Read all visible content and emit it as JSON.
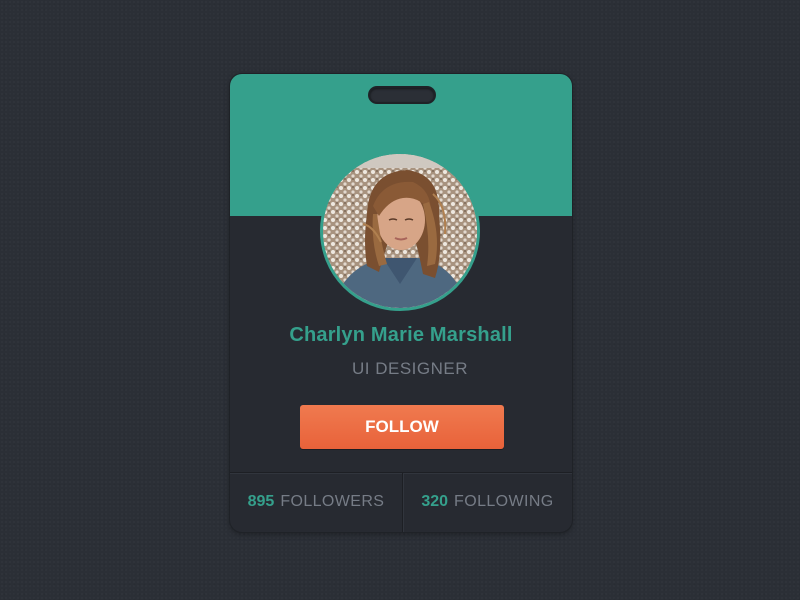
{
  "profile": {
    "name": "Charlyn Marie Marshall",
    "role": "UI DESIGNER",
    "follow_label": "FOLLOW"
  },
  "stats": {
    "followers": {
      "count": "895",
      "label": "FOLLOWERS"
    },
    "following": {
      "count": "320",
      "label": "FOLLOWING"
    }
  },
  "icons": {
    "avatar": "profile-photo"
  },
  "colors": {
    "accent": "#35a08c",
    "button": "#ec6d45",
    "card": "#272a31",
    "background": "#2b2f36",
    "muted_text": "#767c86"
  }
}
